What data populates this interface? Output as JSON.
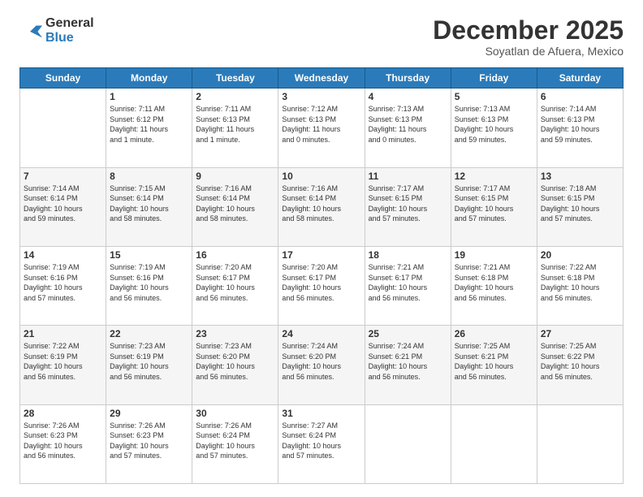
{
  "logo": {
    "general": "General",
    "blue": "Blue"
  },
  "header": {
    "month": "December 2025",
    "location": "Soyatlan de Afuera, Mexico"
  },
  "days_of_week": [
    "Sunday",
    "Monday",
    "Tuesday",
    "Wednesday",
    "Thursday",
    "Friday",
    "Saturday"
  ],
  "weeks": [
    [
      {
        "day": "",
        "info": ""
      },
      {
        "day": "1",
        "info": "Sunrise: 7:11 AM\nSunset: 6:12 PM\nDaylight: 11 hours\nand 1 minute."
      },
      {
        "day": "2",
        "info": "Sunrise: 7:11 AM\nSunset: 6:13 PM\nDaylight: 11 hours\nand 1 minute."
      },
      {
        "day": "3",
        "info": "Sunrise: 7:12 AM\nSunset: 6:13 PM\nDaylight: 11 hours\nand 0 minutes."
      },
      {
        "day": "4",
        "info": "Sunrise: 7:13 AM\nSunset: 6:13 PM\nDaylight: 11 hours\nand 0 minutes."
      },
      {
        "day": "5",
        "info": "Sunrise: 7:13 AM\nSunset: 6:13 PM\nDaylight: 10 hours\nand 59 minutes."
      },
      {
        "day": "6",
        "info": "Sunrise: 7:14 AM\nSunset: 6:13 PM\nDaylight: 10 hours\nand 59 minutes."
      }
    ],
    [
      {
        "day": "7",
        "info": "Sunrise: 7:14 AM\nSunset: 6:14 PM\nDaylight: 10 hours\nand 59 minutes."
      },
      {
        "day": "8",
        "info": "Sunrise: 7:15 AM\nSunset: 6:14 PM\nDaylight: 10 hours\nand 58 minutes."
      },
      {
        "day": "9",
        "info": "Sunrise: 7:16 AM\nSunset: 6:14 PM\nDaylight: 10 hours\nand 58 minutes."
      },
      {
        "day": "10",
        "info": "Sunrise: 7:16 AM\nSunset: 6:14 PM\nDaylight: 10 hours\nand 58 minutes."
      },
      {
        "day": "11",
        "info": "Sunrise: 7:17 AM\nSunset: 6:15 PM\nDaylight: 10 hours\nand 57 minutes."
      },
      {
        "day": "12",
        "info": "Sunrise: 7:17 AM\nSunset: 6:15 PM\nDaylight: 10 hours\nand 57 minutes."
      },
      {
        "day": "13",
        "info": "Sunrise: 7:18 AM\nSunset: 6:15 PM\nDaylight: 10 hours\nand 57 minutes."
      }
    ],
    [
      {
        "day": "14",
        "info": "Sunrise: 7:19 AM\nSunset: 6:16 PM\nDaylight: 10 hours\nand 57 minutes."
      },
      {
        "day": "15",
        "info": "Sunrise: 7:19 AM\nSunset: 6:16 PM\nDaylight: 10 hours\nand 56 minutes."
      },
      {
        "day": "16",
        "info": "Sunrise: 7:20 AM\nSunset: 6:17 PM\nDaylight: 10 hours\nand 56 minutes."
      },
      {
        "day": "17",
        "info": "Sunrise: 7:20 AM\nSunset: 6:17 PM\nDaylight: 10 hours\nand 56 minutes."
      },
      {
        "day": "18",
        "info": "Sunrise: 7:21 AM\nSunset: 6:17 PM\nDaylight: 10 hours\nand 56 minutes."
      },
      {
        "day": "19",
        "info": "Sunrise: 7:21 AM\nSunset: 6:18 PM\nDaylight: 10 hours\nand 56 minutes."
      },
      {
        "day": "20",
        "info": "Sunrise: 7:22 AM\nSunset: 6:18 PM\nDaylight: 10 hours\nand 56 minutes."
      }
    ],
    [
      {
        "day": "21",
        "info": "Sunrise: 7:22 AM\nSunset: 6:19 PM\nDaylight: 10 hours\nand 56 minutes."
      },
      {
        "day": "22",
        "info": "Sunrise: 7:23 AM\nSunset: 6:19 PM\nDaylight: 10 hours\nand 56 minutes."
      },
      {
        "day": "23",
        "info": "Sunrise: 7:23 AM\nSunset: 6:20 PM\nDaylight: 10 hours\nand 56 minutes."
      },
      {
        "day": "24",
        "info": "Sunrise: 7:24 AM\nSunset: 6:20 PM\nDaylight: 10 hours\nand 56 minutes."
      },
      {
        "day": "25",
        "info": "Sunrise: 7:24 AM\nSunset: 6:21 PM\nDaylight: 10 hours\nand 56 minutes."
      },
      {
        "day": "26",
        "info": "Sunrise: 7:25 AM\nSunset: 6:21 PM\nDaylight: 10 hours\nand 56 minutes."
      },
      {
        "day": "27",
        "info": "Sunrise: 7:25 AM\nSunset: 6:22 PM\nDaylight: 10 hours\nand 56 minutes."
      }
    ],
    [
      {
        "day": "28",
        "info": "Sunrise: 7:26 AM\nSunset: 6:23 PM\nDaylight: 10 hours\nand 56 minutes."
      },
      {
        "day": "29",
        "info": "Sunrise: 7:26 AM\nSunset: 6:23 PM\nDaylight: 10 hours\nand 57 minutes."
      },
      {
        "day": "30",
        "info": "Sunrise: 7:26 AM\nSunset: 6:24 PM\nDaylight: 10 hours\nand 57 minutes."
      },
      {
        "day": "31",
        "info": "Sunrise: 7:27 AM\nSunset: 6:24 PM\nDaylight: 10 hours\nand 57 minutes."
      },
      {
        "day": "",
        "info": ""
      },
      {
        "day": "",
        "info": ""
      },
      {
        "day": "",
        "info": ""
      }
    ]
  ]
}
